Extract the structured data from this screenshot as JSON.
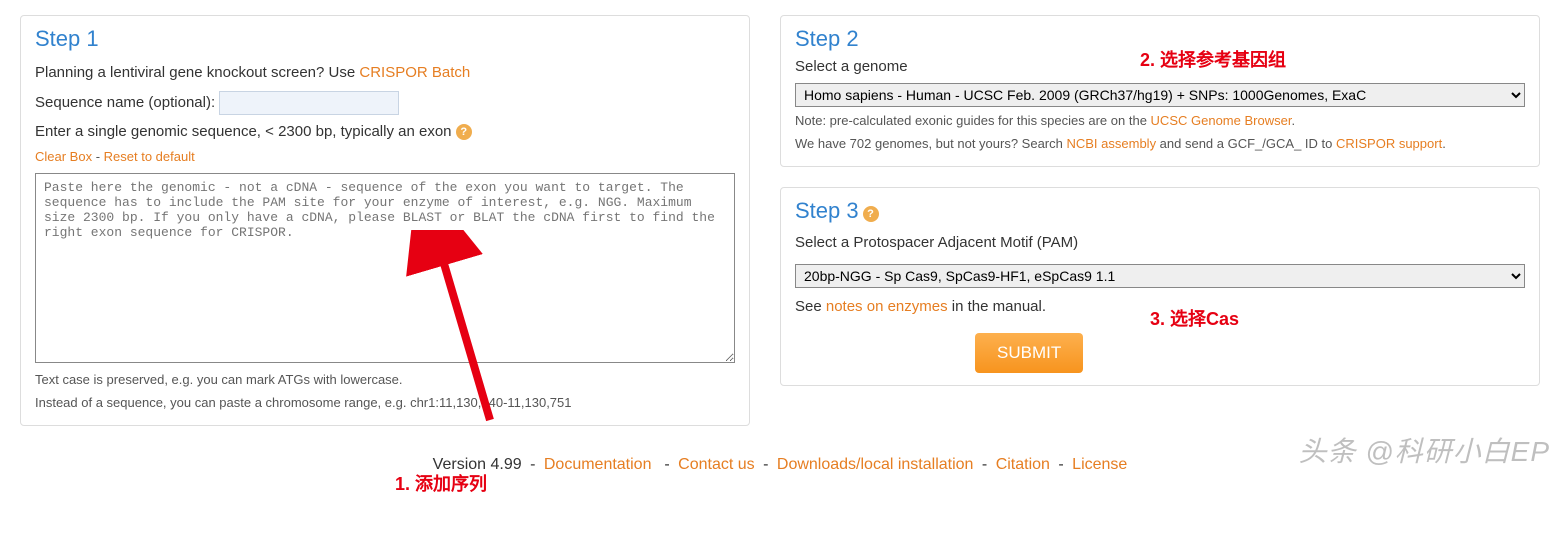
{
  "step1": {
    "title": "Step 1",
    "planning_prefix": "Planning a lentiviral gene knockout screen? Use ",
    "crispor_batch": "CRISPOR Batch",
    "seqname_label": "Sequence name (optional):",
    "seqname_value": "",
    "enter_label": "Enter a single genomic sequence, < 2300 bp, typically an exon",
    "clear_box": "Clear Box",
    "dash": " - ",
    "reset_default": "Reset to default",
    "placeholder": "Paste here the genomic - not a cDNA - sequence of the exon you want to target. The sequence has to include the PAM site for your enzyme of interest, e.g. NGG. Maximum size 2300 bp. If you only have a cDNA, please BLAST or BLAT the cDNA first to find the right exon sequence for CRISPOR.",
    "note1": "Text case is preserved, e.g. you can mark ATGs with lowercase.",
    "note2": "Instead of a sequence, you can paste a chromosome range, e.g. chr1:11,130,540-11,130,751"
  },
  "step2": {
    "title": "Step 2",
    "select_label": "Select a genome",
    "selected": "Homo sapiens - Human - UCSC Feb. 2009 (GRCh37/hg19) + SNPs: 1000Genomes, ExaC",
    "note_prefix": "Note: pre-calculated exonic guides for this species are on the ",
    "ucsc_link": "UCSC Genome Browser",
    "note_suffix": ".",
    "we_have_prefix": "We have 702 genomes, but not yours? Search ",
    "ncbi_link": "NCBI assembly",
    "we_have_mid": " and send a GCF_/GCA_ ID to ",
    "crispor_support": "CRISPOR support",
    "we_have_suffix": "."
  },
  "step3": {
    "title": "Step 3",
    "select_label": "Select a Protospacer Adjacent Motif (PAM)",
    "selected": "20bp-NGG - Sp Cas9, SpCas9-HF1, eSpCas9 1.1",
    "see_prefix": "See ",
    "notes_link": "notes on enzymes",
    "see_suffix": " in the manual.",
    "submit": "SUBMIT"
  },
  "footer": {
    "version": "Version 4.99",
    "documentation": "Documentation",
    "contact": "Contact us",
    "downloads": "Downloads/local installation",
    "citation": "Citation",
    "license": "License"
  },
  "annotations": {
    "a1": "1. 添加序列",
    "a2": "2. 选择参考基因组",
    "a3": "3. 选择Cas"
  },
  "watermark": "头条 @科研小白EP"
}
